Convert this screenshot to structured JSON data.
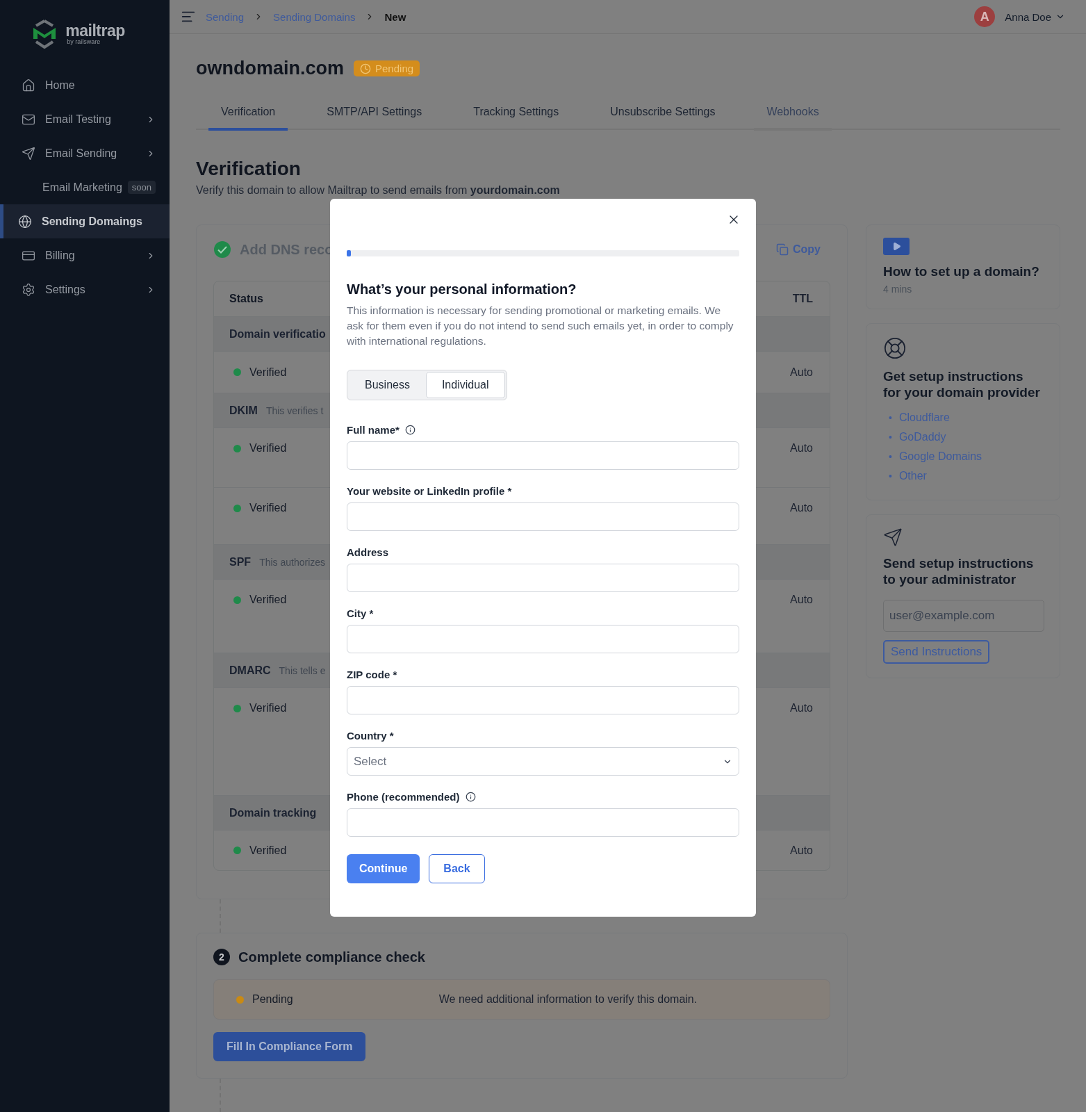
{
  "sidebar": {
    "logo": {
      "name": "mailtrap",
      "tagline": "by railsware"
    },
    "items": [
      {
        "label": "Home",
        "has_submenu": false,
        "selected": false
      },
      {
        "label": "Email Testing",
        "has_submenu": true,
        "selected": false
      },
      {
        "label": "Email Sending",
        "has_submenu": true,
        "selected": false
      },
      {
        "label": "Email Marketing",
        "badge": "soon",
        "has_submenu": false,
        "selected": false
      },
      {
        "label": "Sending Domaings",
        "has_submenu": false,
        "selected": true
      },
      {
        "label": "Billing",
        "has_submenu": true,
        "selected": false
      },
      {
        "label": "Settings",
        "has_submenu": true,
        "selected": false
      }
    ]
  },
  "header": {
    "breadcrumbs": [
      {
        "label": "Sending",
        "current": false
      },
      {
        "label": "Sending Domains",
        "current": false
      },
      {
        "label": "New",
        "current": true
      }
    ],
    "user": {
      "initial": "A",
      "name": "Anna Doe"
    }
  },
  "page": {
    "domain": "owndomain.com",
    "status": "Pending",
    "tabs": [
      {
        "label": "Verification",
        "selected": true,
        "hovered": false
      },
      {
        "label": "SMTP/API Settings",
        "selected": false,
        "hovered": false
      },
      {
        "label": "Tracking Settings",
        "selected": false,
        "hovered": false
      },
      {
        "label": "Unsubscribe Settings",
        "selected": false,
        "hovered": false
      },
      {
        "label": "Webhooks",
        "selected": false,
        "hovered": true
      }
    ],
    "section_title": "Verification",
    "section_text": "Verify this domain to allow Mailtrap to send emails from **yourdomain.com**"
  },
  "dns_step": {
    "done": true,
    "title": "Add DNS reco",
    "copy_label": "Copy",
    "columns": {
      "status": "Status",
      "ttl": "TTL"
    },
    "groups": [
      {
        "name": "Domain verificatio",
        "records": [
          {
            "status": "Verified",
            "color": "#1f8a4a",
            "ttl": "Auto"
          }
        ]
      },
      {
        "name": "DKIM",
        "description": "This verifies t",
        "records": [
          {
            "status": "Verified",
            "color": "#1f8a4a",
            "ttl": "Auto"
          },
          {
            "status": "Verified",
            "color": "#1f8a4a",
            "ttl": "Auto"
          }
        ]
      },
      {
        "name": "SPF",
        "description": "This authorizes",
        "records": [
          {
            "status": "Verified",
            "color": "#1f8a4a",
            "ttl": "Auto"
          }
        ]
      },
      {
        "name": "DMARC",
        "description": "This tells e",
        "records": [
          {
            "status": "Verified",
            "color": "#1f8a4a",
            "ttl": "Auto"
          }
        ]
      },
      {
        "name": "Domain tracking",
        "records": [
          {
            "status": "Verified",
            "color": "#1f8a4a",
            "ttl": "Auto"
          }
        ]
      }
    ]
  },
  "compliance": {
    "step": "2",
    "title": "Complete compliance check",
    "status": {
      "label": "Pending",
      "color": "#c98a14"
    },
    "message": "We need additional information to verify this domain.",
    "button": "Fill In Compliance Form"
  },
  "aside": {
    "video": {
      "title": "How to set up a domain?",
      "duration": "4 mins"
    },
    "providers": {
      "title": "Get setup instructions for your domain provider",
      "marker": "•",
      "links": [
        "Cloudflare",
        "GoDaddy",
        "Google Domains",
        "Other"
      ]
    },
    "admin": {
      "title": "Send setup instructions to your administrator",
      "placeholder": "user@example.com",
      "button": "Send Instructions"
    }
  },
  "modal": {
    "progress": {
      "level": 0.01
    },
    "title": "What’s your personal information?",
    "description": "This information is necessary for sending promotional or marketing emails. We ask for them even if you do not intend to send such emails yet, in order to comply with international regulations.",
    "type_toggle": [
      {
        "label": "Business",
        "selected": false
      },
      {
        "label": "Individual",
        "selected": true
      }
    ],
    "fields": [
      {
        "kind": "text",
        "label": "Full name*",
        "info": true
      },
      {
        "kind": "text",
        "label": "Your website or LinkedIn profile *",
        "info": false
      },
      {
        "kind": "text",
        "label": "Address",
        "info": false
      },
      {
        "kind": "text",
        "label": "City *",
        "info": false
      },
      {
        "kind": "text",
        "label": "ZIP code *",
        "info": false
      },
      {
        "kind": "select",
        "label": "Country *",
        "placeholder": "Select",
        "info": false
      },
      {
        "kind": "text",
        "label": "Phone (recommended)",
        "info": true
      }
    ],
    "buttons": {
      "primary": "Continue",
      "secondary": "Back"
    }
  }
}
